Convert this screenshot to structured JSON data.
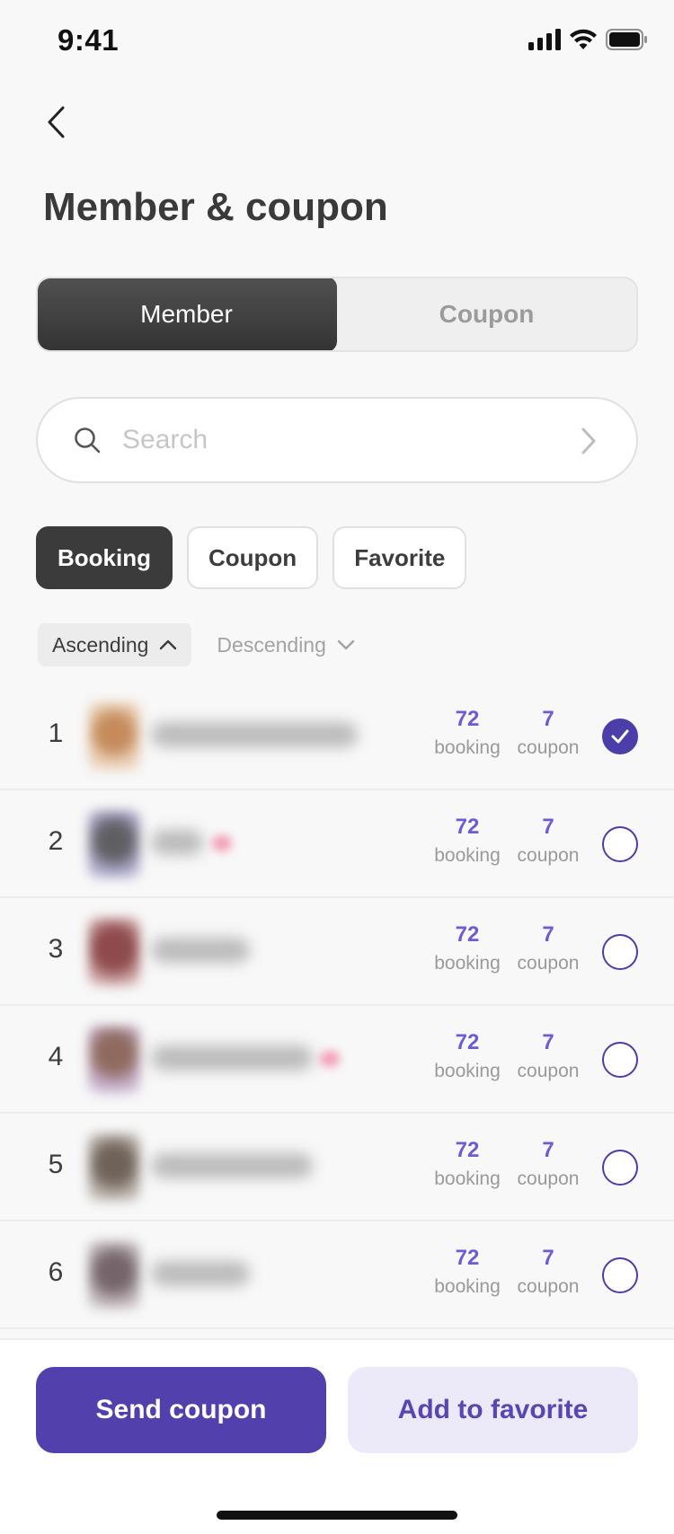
{
  "status_bar": {
    "time": "9:41"
  },
  "header": {
    "title": "Member & coupon"
  },
  "segments": {
    "member": "Member",
    "coupon": "Coupon"
  },
  "search": {
    "placeholder": "Search"
  },
  "filters": {
    "booking": "Booking",
    "coupon": "Coupon",
    "favorite": "Favorite"
  },
  "sort": {
    "ascending": "Ascending",
    "descending": "Descending"
  },
  "members": [
    {
      "rank": "1",
      "bookings": "72",
      "booking_label": "booking",
      "coupons": "7",
      "coupon_label": "coupon",
      "selected": true
    },
    {
      "rank": "2",
      "bookings": "72",
      "booking_label": "booking",
      "coupons": "7",
      "coupon_label": "coupon",
      "selected": false
    },
    {
      "rank": "3",
      "bookings": "72",
      "booking_label": "booking",
      "coupons": "7",
      "coupon_label": "coupon",
      "selected": false
    },
    {
      "rank": "4",
      "bookings": "72",
      "booking_label": "booking",
      "coupons": "7",
      "coupon_label": "coupon",
      "selected": false
    },
    {
      "rank": "5",
      "bookings": "72",
      "booking_label": "booking",
      "coupons": "7",
      "coupon_label": "coupon",
      "selected": false
    },
    {
      "rank": "6",
      "bookings": "72",
      "booking_label": "booking",
      "coupons": "7",
      "coupon_label": "coupon",
      "selected": false
    }
  ],
  "actions": {
    "send_coupon": "Send coupon",
    "add_favorite": "Add to favorite"
  },
  "colors": {
    "accent": "#5241ac",
    "accent_light": "#ece9f8",
    "stat_number": "#6b5bd6",
    "dark": "#3b3b3b"
  }
}
